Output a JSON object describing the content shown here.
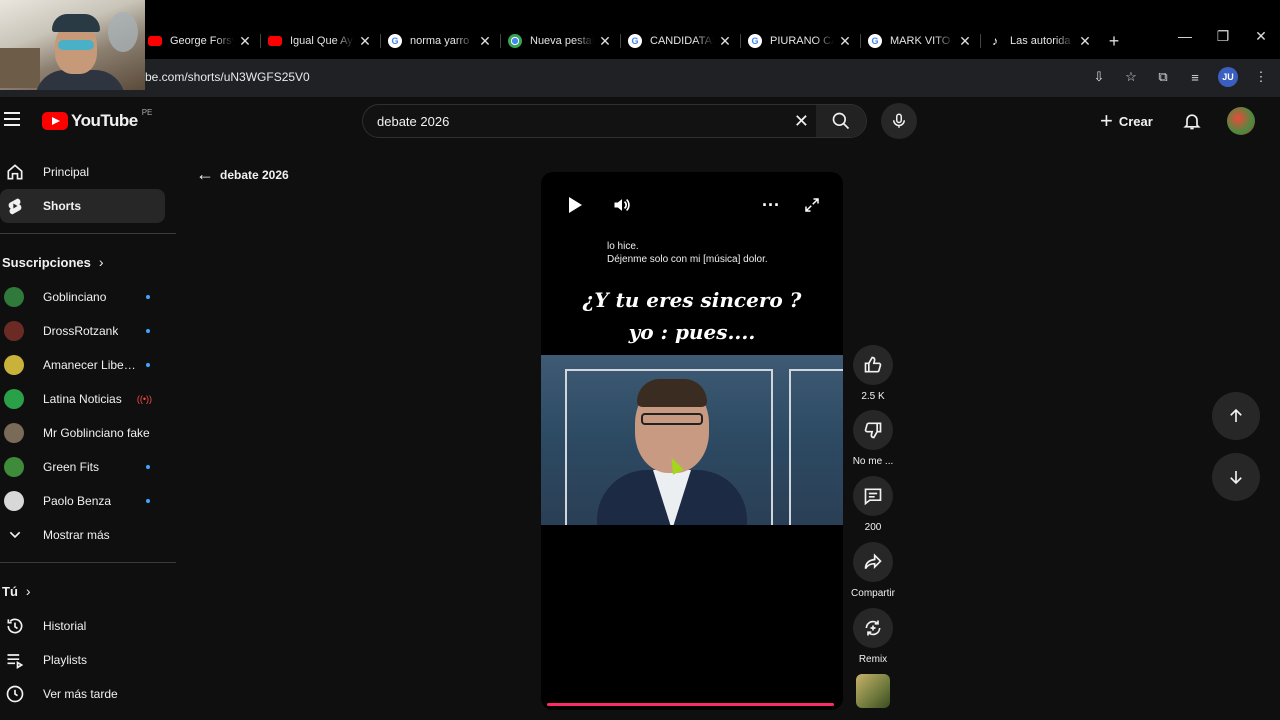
{
  "browser": {
    "tabs": [
      {
        "title": "George Forsy",
        "icon": "youtube-icon"
      },
      {
        "title": "Igual Que Ay",
        "icon": "youtube-icon"
      },
      {
        "title": "norma yarro",
        "icon": "google-icon"
      },
      {
        "title": "Nueva pestaí",
        "icon": "chrome-icon"
      },
      {
        "title": "CANDIDATAS",
        "icon": "google-icon"
      },
      {
        "title": "PIURANO CA",
        "icon": "google-icon"
      },
      {
        "title": "MARK VITO -",
        "icon": "google-icon"
      },
      {
        "title": "Las autorida",
        "icon": "tiktok-icon"
      }
    ],
    "url": "be.com/shorts/uN3WGFS25V0",
    "profile_initials": "JU"
  },
  "header": {
    "logo": "YouTube",
    "country": "PE",
    "search_value": "debate 2026",
    "create_label": "Crear"
  },
  "sidebar": {
    "main": [
      {
        "label": "Principal",
        "icon": "home-icon"
      },
      {
        "label": "Shorts",
        "icon": "shorts-icon"
      }
    ],
    "subs_header": "Suscripciones",
    "subscriptions": [
      {
        "name": "Goblinciano",
        "color": "#2f7a3a",
        "badge": "dot"
      },
      {
        "name": "DrossRotzank",
        "color": "#6b2a24",
        "badge": "dot"
      },
      {
        "name": "Amanecer Libert…",
        "color": "#c9b23a",
        "badge": "dot"
      },
      {
        "name": "Latina Noticias",
        "color": "#2aa148",
        "badge": "live"
      },
      {
        "name": "Mr Goblinciano fake",
        "color": "#7a6a58",
        "badge": "none"
      },
      {
        "name": "Green Fits",
        "color": "#3e8c3a",
        "badge": "dot"
      },
      {
        "name": "Paolo Benza",
        "color": "#d8d8d8",
        "badge": "dot"
      }
    ],
    "show_more": "Mostrar más",
    "you_header": "Tú",
    "you": [
      {
        "label": "Historial",
        "icon": "history-icon"
      },
      {
        "label": "Playlists",
        "icon": "playlists-icon"
      },
      {
        "label": "Ver más tarde",
        "icon": "clock-icon"
      }
    ]
  },
  "back": {
    "label": "debate 2026"
  },
  "short": {
    "caption_line1": "lo hice.",
    "caption_line2": "Déjenme solo con mi [música] dolor.",
    "overlay_line1": "¿Y tu eres sincero ?",
    "overlay_line2": "yo : pues....",
    "progress": 0.97
  },
  "actions": {
    "likes": "2.5 K",
    "dislike_label": "No me ...",
    "comments": "200",
    "share_label": "Compartir",
    "remix_label": "Remix"
  }
}
